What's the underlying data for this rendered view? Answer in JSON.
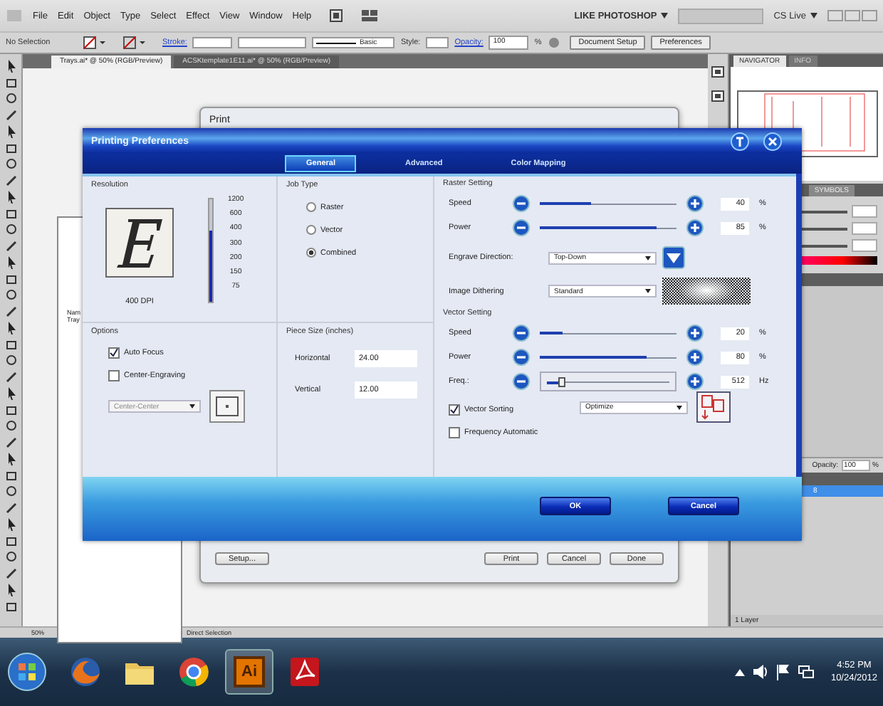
{
  "app": {
    "menus": [
      "File",
      "Edit",
      "Object",
      "Type",
      "Select",
      "Effect",
      "View",
      "Window",
      "Help"
    ],
    "workspace": "LIKE PHOTOSHOP",
    "cs_live": "CS Live"
  },
  "control_bar": {
    "selection": "No Selection",
    "stroke_label": "Stroke:",
    "brush": "Basic",
    "style_label": "Style:",
    "opacity_label": "Opacity:",
    "opacity": "100",
    "opacity_unit": "%",
    "buttons": [
      "Document Setup",
      "Preferences"
    ]
  },
  "document_tabs": [
    {
      "label": "Trays.ai* @ 50% (RGB/Preview)",
      "selected": true
    },
    {
      "label": "ACSKtemplate1E11.ai* @ 50% (RGB/Preview)",
      "selected": false
    }
  ],
  "artboard_text": [
    "Nam",
    "Tray"
  ],
  "print_dialog": {
    "title": "Print",
    "buttons": [
      "Setup...",
      "Print",
      "Cancel",
      "Done"
    ]
  },
  "preferences": {
    "title": "Printing Preferences",
    "tabs": [
      {
        "label": "General",
        "selected": true
      },
      {
        "label": "Advanced",
        "selected": false
      },
      {
        "label": "Color Mapping",
        "selected": false
      }
    ],
    "resolution": {
      "label": "Resolution",
      "reading": "400 DPI",
      "scale": [
        "1200",
        "600",
        "400",
        "300",
        "200",
        "150",
        "75"
      ],
      "level": 0.7
    },
    "job_type": {
      "label": "Job Type",
      "options": [
        {
          "label": "Raster",
          "selected": false
        },
        {
          "label": "Vector",
          "selected": false
        },
        {
          "label": "Combined",
          "selected": true
        }
      ]
    },
    "options": {
      "label": "Options",
      "checkboxes": [
        {
          "label": "Auto Focus",
          "checked": true
        },
        {
          "label": "Center-Engraving",
          "checked": false
        }
      ],
      "position": "Center-Center"
    },
    "piece_size": {
      "label": "Piece Size (inches)",
      "fields": [
        {
          "label": "Horizontal",
          "value": "24.00"
        },
        {
          "label": "Vertical",
          "value": "12.00"
        }
      ]
    },
    "raster": {
      "label": "Raster Setting",
      "sliders": [
        {
          "kind": "bar",
          "label": "Speed",
          "level": 0.38,
          "value": "40",
          "unit": "%"
        },
        {
          "kind": "bar",
          "label": "Power",
          "level": 0.85,
          "value": "85",
          "unit": "%"
        }
      ],
      "engrave_direction": {
        "label": "Engrave Direction:",
        "value": "Top-Down"
      },
      "dithering": {
        "label": "Image Dithering",
        "value": "Standard"
      }
    },
    "vector": {
      "label": "Vector Setting",
      "sliders": [
        {
          "kind": "bar",
          "label": "Speed",
          "level": 0.17,
          "value": "20",
          "unit": "%"
        },
        {
          "kind": "bar",
          "label": "Power",
          "level": 0.78,
          "value": "80",
          "unit": "%"
        },
        {
          "kind": "thumb",
          "label": "Freq.:",
          "level": 0.12,
          "value": "512",
          "unit": "Hz"
        }
      ],
      "checkboxes": [
        {
          "label": "Vector Sorting",
          "checked": true
        },
        {
          "label": "Frequency Automatic",
          "checked": false
        }
      ],
      "sorting": "Optimize"
    },
    "buttons": [
      "OK",
      "Cancel"
    ]
  },
  "panels": {
    "tabs": [
      {
        "label": "NAVIGATOR",
        "selected": true
      },
      {
        "label": "INFO",
        "selected": false
      }
    ],
    "symbols": "SYMBOLS",
    "opacity_label": "Opacity:",
    "opacity": "100",
    "opacity_unit": "%",
    "layer": "8",
    "layers_count": "1 Layer"
  },
  "status_bar": {
    "zoom": "50%",
    "tool": "Direct Selection"
  },
  "taskbar": {
    "items": [
      {
        "kind": "firefox"
      },
      {
        "kind": "folder"
      },
      {
        "kind": "chrome"
      },
      {
        "kind": "illustrator",
        "label": "Ai"
      },
      {
        "kind": "acrobat"
      }
    ],
    "time": "4:52 PM",
    "date": "10/24/2012"
  }
}
